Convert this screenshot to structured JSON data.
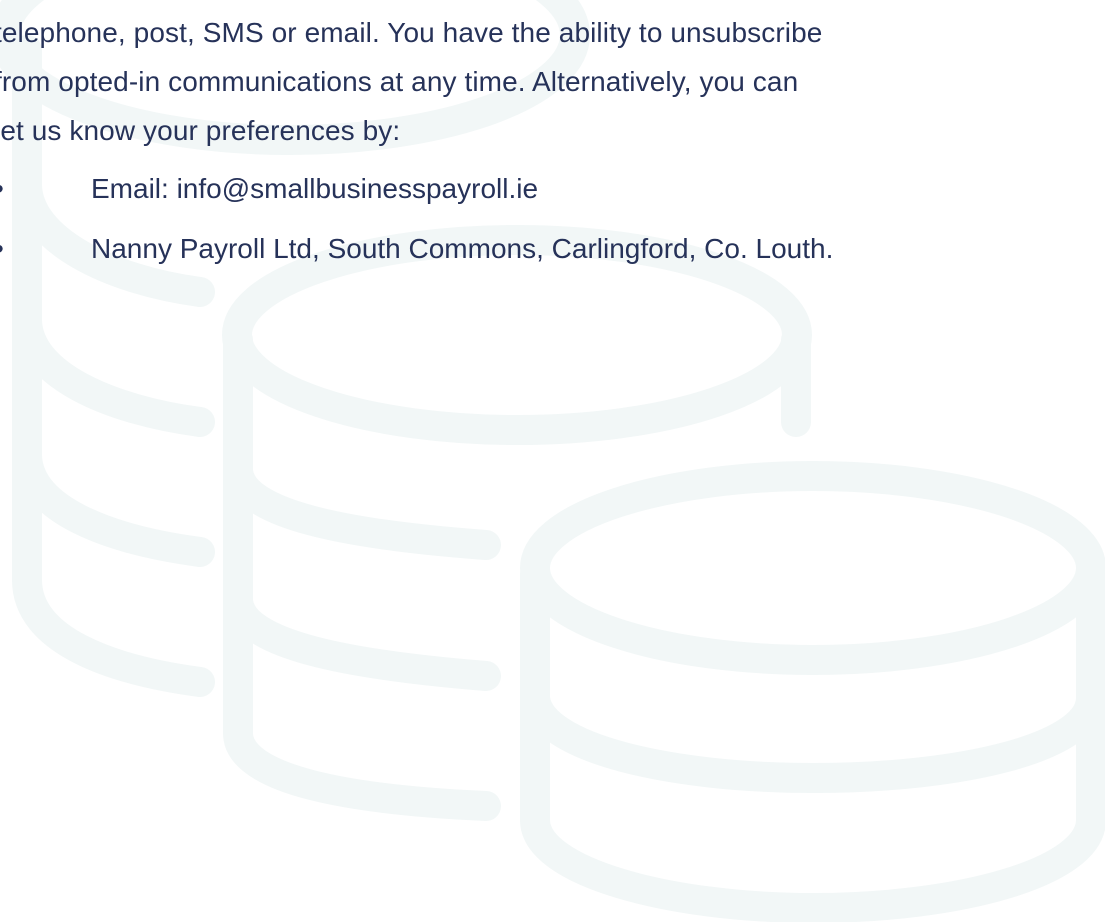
{
  "document": {
    "paragraph_lines": [
      "telephone, post, SMS or email. You have the ability to unsubscribe",
      "from opted-in communications at any time. Alternatively, you can",
      "let us know your preferences by:"
    ],
    "bullets": [
      {
        "marker": "•",
        "text": "Email: info@smallbusinesspayroll.ie"
      },
      {
        "marker": "•",
        "text": "Nanny Payroll Ltd, South Commons, Carlingford, Co. Louth."
      }
    ]
  },
  "colors": {
    "text": "#263259",
    "watermark": "#f2f7f7",
    "background": "#ffffff"
  },
  "watermark": {
    "icon": "coin-stack-icon"
  }
}
